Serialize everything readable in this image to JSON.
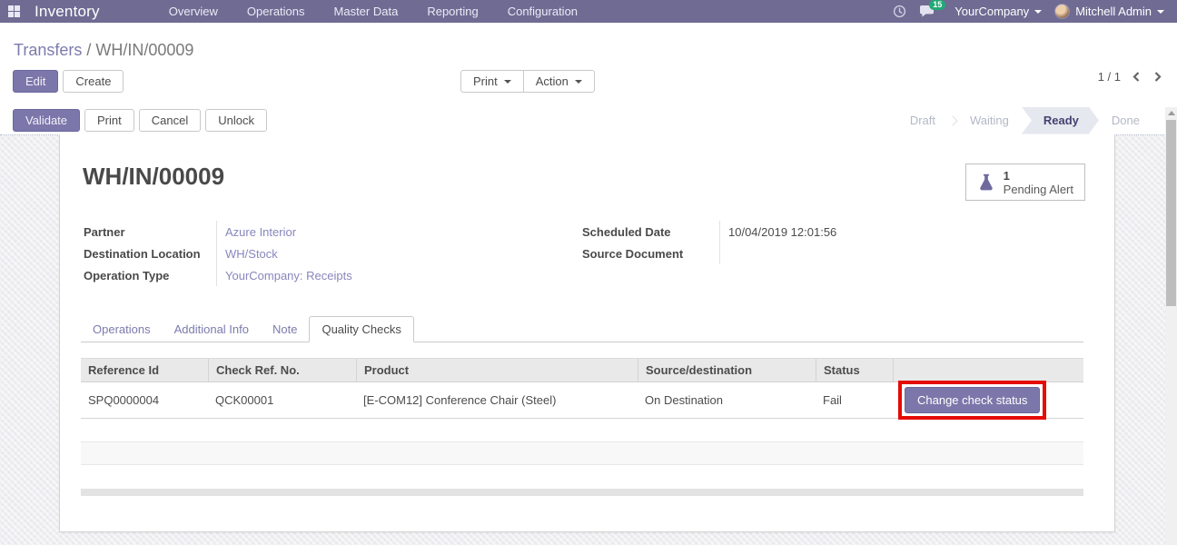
{
  "colors": {
    "navbar-bg": "#6f6b93",
    "accent": "#7b77aa",
    "accent-border": "#6c689c",
    "link": "#7c7bad",
    "value-link": "#8886bd",
    "badge": "#23a977",
    "annotation": "#e50b07",
    "step-active-bg": "#e5e8ef",
    "step-active-text": "#454170",
    "table-header-bg": "#e9e9e9",
    "stripe": "#f8f8f9"
  },
  "navbar": {
    "brand": "Inventory",
    "menu_items": [
      "Overview",
      "Operations",
      "Master Data",
      "Reporting",
      "Configuration"
    ],
    "message_count": "15",
    "company": "YourCompany",
    "user": "Mitchell Admin"
  },
  "breadcrumb": {
    "parent": "Transfers",
    "separator": " / ",
    "current": "WH/IN/00009"
  },
  "control_panel": {
    "edit": "Edit",
    "create": "Create",
    "print": "Print",
    "action": "Action",
    "pager": "1 / 1"
  },
  "statusbar": {
    "validate": "Validate",
    "print": "Print",
    "cancel": "Cancel",
    "unlock": "Unlock",
    "steps": [
      "Draft",
      "Waiting",
      "Ready",
      "Done"
    ]
  },
  "sheet": {
    "title": "WH/IN/00009",
    "alert": {
      "count": "1",
      "label": "Pending Alert"
    },
    "fields_left": [
      {
        "label": "Partner",
        "value": "Azure Interior"
      },
      {
        "label": "Destination Location",
        "value": "WH/Stock"
      },
      {
        "label": "Operation Type",
        "value": "YourCompany: Receipts"
      }
    ],
    "fields_right": [
      {
        "label": "Scheduled Date",
        "value": "10/04/2019 12:01:56"
      },
      {
        "label": "Source Document",
        "value": ""
      }
    ],
    "tabs": [
      "Operations",
      "Additional Info",
      "Note",
      "Quality Checks"
    ],
    "active_tab": "Quality Checks",
    "table": {
      "headers": [
        "Reference Id",
        "Check Ref. No.",
        "Product",
        "Source/destination",
        "Status",
        ""
      ],
      "rows": [
        {
          "reference_id": "SPQ0000004",
          "check_ref": "QCK00001",
          "product": "[E-COM12] Conference Chair (Steel)",
          "source_destination": "On Destination",
          "status": "Fail",
          "action": "Change check status"
        }
      ]
    }
  }
}
